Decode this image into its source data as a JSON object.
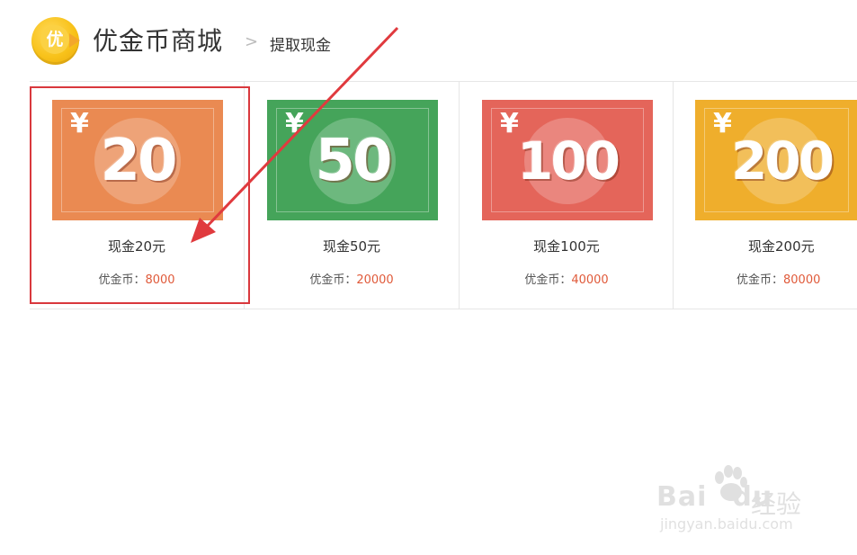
{
  "header": {
    "logo_char": "优",
    "title": "优金币商城",
    "breadcrumb_sep": ">",
    "breadcrumb": "提取现金"
  },
  "cards": [
    {
      "image_label": "20",
      "currency": "¥",
      "name": "现金20元",
      "price_label": "优金币：",
      "price": "8000",
      "color": "#ea8a52"
    },
    {
      "image_label": "50",
      "currency": "¥",
      "name": "现金50元",
      "price_label": "优金币：",
      "price": "20000",
      "color": "#45a45a"
    },
    {
      "image_label": "100",
      "currency": "¥",
      "name": "现金100元",
      "price_label": "优金币：",
      "price": "40000",
      "color": "#e4655a"
    },
    {
      "image_label": "200",
      "currency": "¥",
      "name": "现金200元",
      "price_label": "优金币：",
      "price": "80000",
      "color": "#efae2c"
    }
  ],
  "annotation": {
    "highlight_color": "#d9383d"
  },
  "watermark": {
    "brand": "Bai",
    "brand2": "du",
    "text": "经验",
    "url": "jingyan.baidu.com"
  }
}
